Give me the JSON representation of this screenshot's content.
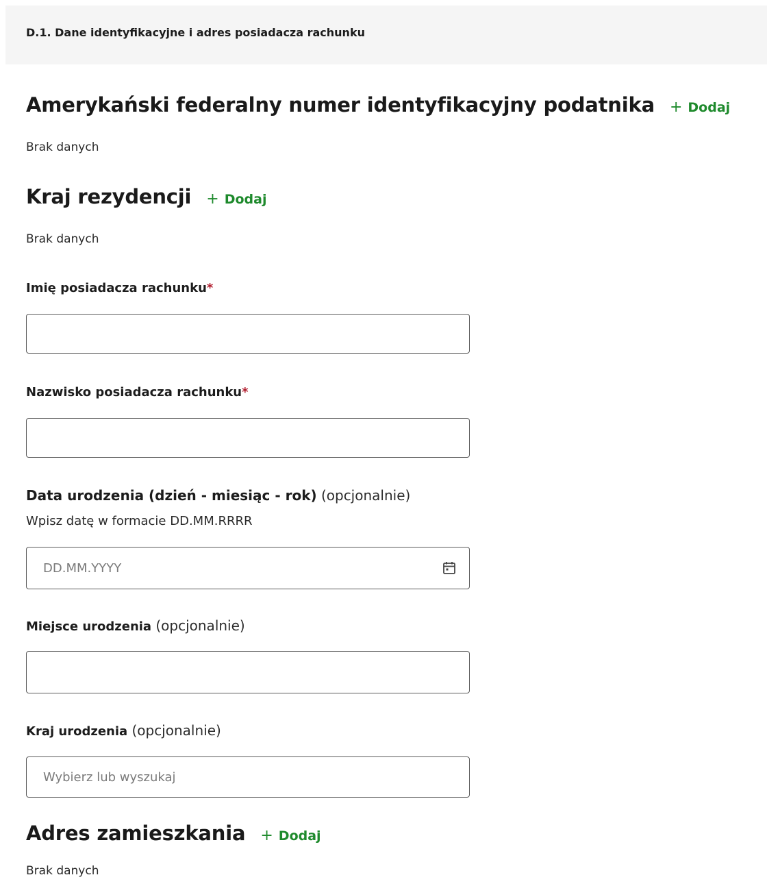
{
  "section": {
    "title": "D.1. Dane identyfikacyjne i adres posiadacza rachunku"
  },
  "tin": {
    "heading": "Amerykański federalny numer identyfikacyjny podatnika",
    "add_label": "Dodaj",
    "empty": "Brak danych"
  },
  "residence": {
    "heading": "Kraj rezydencji",
    "add_label": "Dodaj",
    "empty": "Brak danych"
  },
  "first_name": {
    "label": "Imię posiadacza rachunku",
    "required_mark": "*",
    "value": ""
  },
  "last_name": {
    "label": "Nazwisko posiadacza rachunku",
    "required_mark": "*",
    "value": ""
  },
  "birth_date": {
    "label": "Data urodzenia (dzień - miesiąc - rok)",
    "optional": "(opcjonalnie)",
    "hint": "Wpisz datę w formacie DD.MM.RRRR",
    "placeholder": "DD.MM.YYYY",
    "value": ""
  },
  "birth_place": {
    "label": "Miejsce urodzenia",
    "optional": "(opcjonalnie)",
    "value": ""
  },
  "birth_country": {
    "label": "Kraj urodzenia",
    "optional": "(opcjonalnie)",
    "placeholder": "Wybierz lub wyszukaj"
  },
  "address": {
    "heading": "Adres zamieszkania",
    "add_label": "Dodaj",
    "empty": "Brak danych"
  },
  "icons": {
    "add": "plus-icon",
    "date": "calendar-icon"
  },
  "colors": {
    "accent": "#1e8a2c",
    "required": "#b11c2d",
    "header_bg": "#f5f5f5"
  }
}
